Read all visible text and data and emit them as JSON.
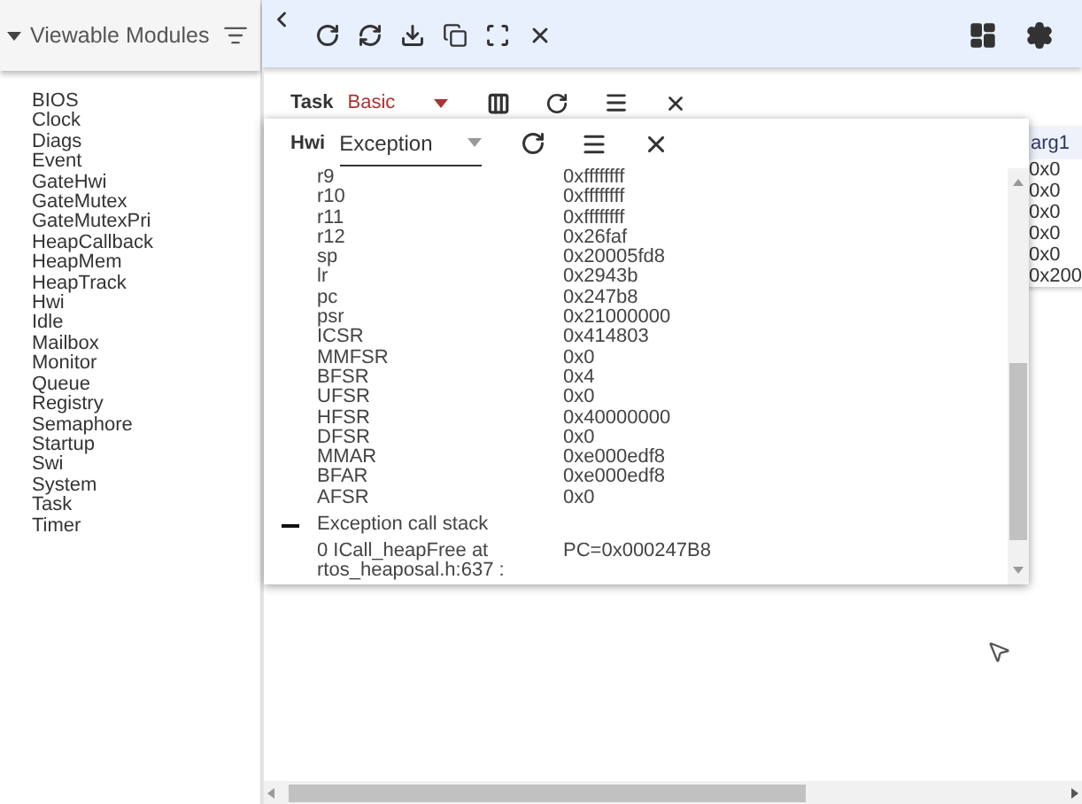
{
  "sidebar": {
    "title": "Viewable Modules",
    "expanded": true,
    "items": [
      "BIOS",
      "Clock",
      "Diags",
      "Event",
      "GateHwi",
      "GateMutex",
      "GateMutexPri",
      "HeapCallback",
      "HeapMem",
      "HeapTrack",
      "Hwi",
      "Idle",
      "Mailbox",
      "Monitor",
      "Queue",
      "Registry",
      "Semaphore",
      "Startup",
      "Swi",
      "System",
      "Task",
      "Timer"
    ]
  },
  "task_view": {
    "label": "Task",
    "view": "Basic"
  },
  "hwi_view": {
    "label": "Hwi",
    "view": "Exception",
    "registers": [
      {
        "name": "r9",
        "value": "0xffffffff"
      },
      {
        "name": "r10",
        "value": "0xffffffff"
      },
      {
        "name": "r11",
        "value": "0xffffffff"
      },
      {
        "name": "r12",
        "value": "0x26faf"
      },
      {
        "name": "sp",
        "value": "0x20005fd8"
      },
      {
        "name": "lr",
        "value": "0x2943b"
      },
      {
        "name": "pc",
        "value": "0x247b8"
      },
      {
        "name": "psr",
        "value": "0x21000000"
      },
      {
        "name": "ICSR",
        "value": "0x414803"
      },
      {
        "name": "MMFSR",
        "value": "0x0"
      },
      {
        "name": "BFSR",
        "value": "0x4"
      },
      {
        "name": "UFSR",
        "value": "0x0"
      },
      {
        "name": "HFSR",
        "value": "0x40000000"
      },
      {
        "name": "DFSR",
        "value": "0x0"
      },
      {
        "name": "MMAR",
        "value": "0xe000edf8"
      },
      {
        "name": "BFAR",
        "value": "0xe000edf8"
      },
      {
        "name": "AFSR",
        "value": "0x0"
      }
    ],
    "call_stack": {
      "title": "Exception call stack",
      "expanded": true,
      "frames": [
        {
          "location": "0 ICall_heapFree at rtos_heaposal.h:637 :",
          "pc": "PC=0x000247B8"
        }
      ]
    }
  },
  "task_table": {
    "column": "arg1",
    "cells": [
      "0x0",
      "0x0",
      "0x0",
      "0x0",
      "0x0",
      "0x200"
    ]
  }
}
